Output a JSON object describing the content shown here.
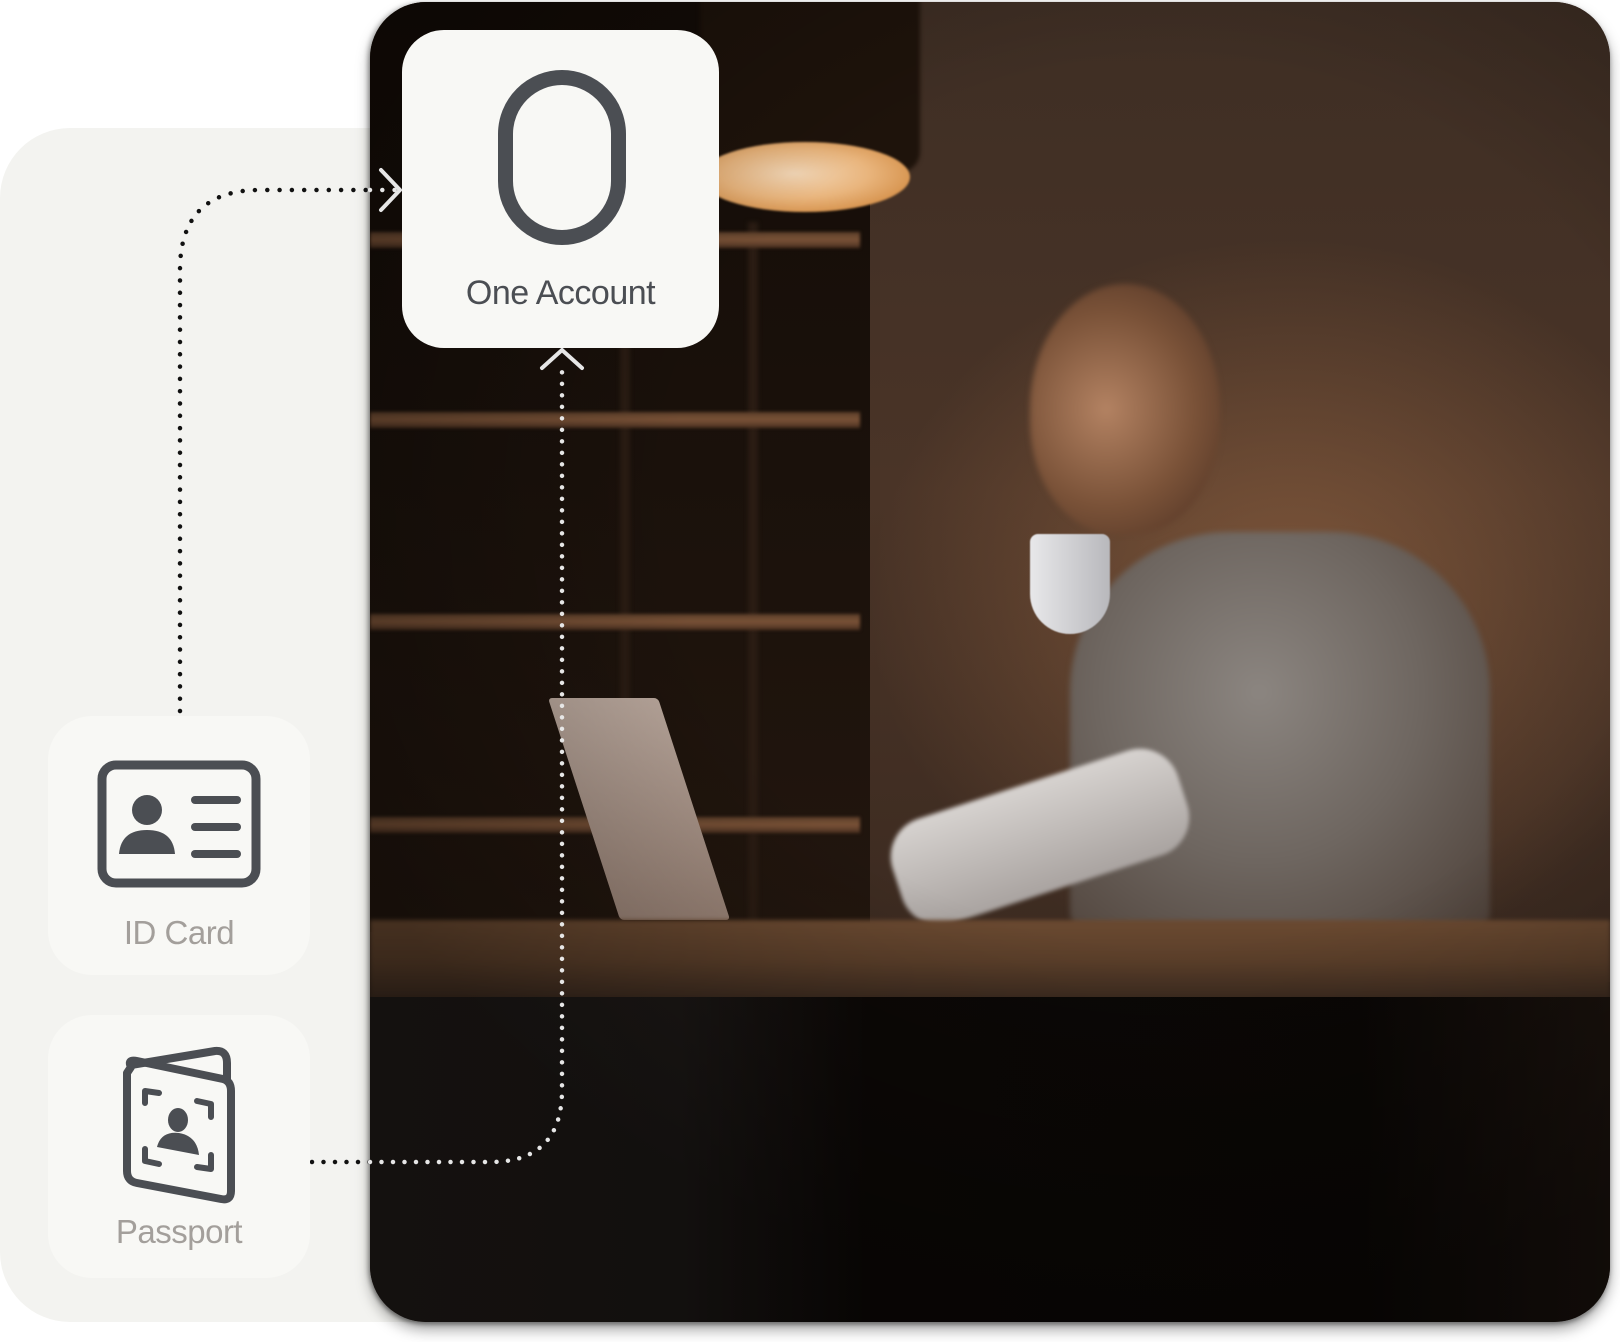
{
  "diagram": {
    "target": {
      "label": "One Account",
      "icon": "account-ring-icon"
    },
    "sources": [
      {
        "label": "ID Card",
        "icon": "id-card-icon"
      },
      {
        "label": "Passport",
        "icon": "passport-icon"
      }
    ],
    "connections": [
      {
        "from": "ID Card",
        "to": "One Account",
        "arrow": "chevron-right-icon"
      },
      {
        "from": "Passport",
        "to": "One Account",
        "arrow": "chevron-up-icon"
      }
    ]
  },
  "photo": {
    "subject": "woman-at-desk-drinking-coffee-with-laptop"
  },
  "colors": {
    "icon": "#4b4e53",
    "label_muted": "#a39f9b",
    "card_bg": "#f8f8f5",
    "panel_bg": "#f3f3f0",
    "connector_on_light": "#111111",
    "connector_on_photo": "#e6e6e6"
  }
}
